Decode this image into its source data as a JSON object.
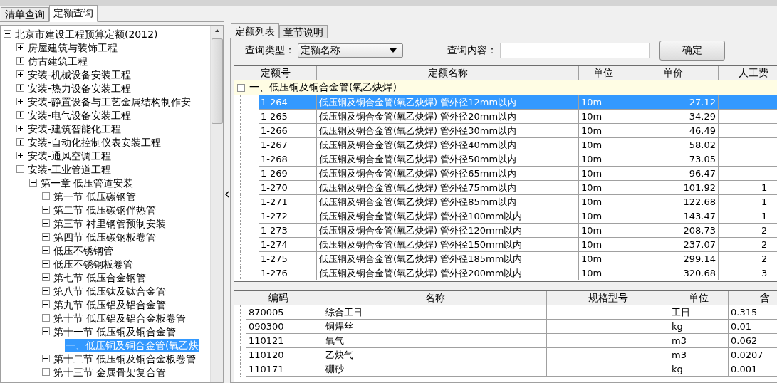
{
  "left_tabs": [
    {
      "label": "清单查询",
      "selected": false
    },
    {
      "label": "定额查询",
      "selected": true
    }
  ],
  "tree": [
    {
      "label": "北京市建设工程预算定额(2012)",
      "expanded": true,
      "selected": false,
      "children": [
        {
          "label": "房屋建筑与装饰工程",
          "expanded": false,
          "selected": false
        },
        {
          "label": "仿古建筑工程",
          "expanded": false,
          "selected": false
        },
        {
          "label": "安装-机械设备安装工程",
          "expanded": false,
          "selected": false
        },
        {
          "label": "安装-热力设备安装工程",
          "expanded": false,
          "selected": false
        },
        {
          "label": "安装-静置设备与工艺金属结构制作安",
          "expanded": false,
          "selected": false
        },
        {
          "label": "安装-电气设备安装工程",
          "expanded": false,
          "selected": false
        },
        {
          "label": "安装-建筑智能化工程",
          "expanded": false,
          "selected": false
        },
        {
          "label": "安装-自动化控制仪表安装工程",
          "expanded": false,
          "selected": false
        },
        {
          "label": "安装-通风空调工程",
          "expanded": false,
          "selected": false
        },
        {
          "label": "安装-工业管道工程",
          "expanded": true,
          "selected": false,
          "children": [
            {
              "label": "第一章  低压管道安装",
              "expanded": true,
              "selected": false,
              "children": [
                {
                  "label": "第一节  低压碳钢管",
                  "expanded": false,
                  "selected": false
                },
                {
                  "label": "第二节  低压碳钢伴热管",
                  "expanded": false,
                  "selected": false
                },
                {
                  "label": "第三节  衬里钢管预制安装",
                  "expanded": false,
                  "selected": false
                },
                {
                  "label": "第四节  低压碳钢板卷管",
                  "expanded": false,
                  "selected": false
                },
                {
                  "label": "低压不锈钢管",
                  "expanded": false,
                  "selected": false
                },
                {
                  "label": "低压不锈钢板卷管",
                  "expanded": false,
                  "selected": false
                },
                {
                  "label": "第七节  低压合金钢管",
                  "expanded": false,
                  "selected": false
                },
                {
                  "label": "第八节  低压钛及钛合金管",
                  "expanded": false,
                  "selected": false
                },
                {
                  "label": "第九节  低压铝及铝合金管",
                  "expanded": false,
                  "selected": false
                },
                {
                  "label": "第十节  低压铝及铝合金板卷管",
                  "expanded": false,
                  "selected": false
                },
                {
                  "label": "第十一节  低压铜及铜合金管",
                  "expanded": true,
                  "selected": false,
                  "children": [
                    {
                      "label": "一、低压铜及铜合金管(氧乙炔",
                      "selected": true
                    }
                  ]
                },
                {
                  "label": "第十二节  低压铜及铜合金板卷管",
                  "expanded": false,
                  "selected": false
                },
                {
                  "label": "第十三节  金属骨架复合管",
                  "expanded": false,
                  "selected": false
                }
              ]
            }
          ]
        }
      ]
    }
  ],
  "right_tabs": [
    {
      "label": "定额列表",
      "selected": true
    },
    {
      "label": "章节说明",
      "selected": false
    }
  ],
  "query": {
    "type_label": "查询类型：",
    "type_value": "定额名称",
    "content_label": "查询内容：",
    "confirm": "确定"
  },
  "quota_table": {
    "columns": [
      "定额号",
      "定额名称",
      "单位",
      "单价",
      "人工费"
    ],
    "group": {
      "label": "一、低压铜及铜合金管(氧乙炔焊)",
      "expanded": true
    },
    "rows": [
      {
        "code": "1-264",
        "name": "低压铜及铜合金管(氧乙炔焊) 管外径12mm以内",
        "unit": "10m",
        "price": "27.12",
        "selected": true
      },
      {
        "code": "1-265",
        "name": "低压铜及铜合金管(氧乙炔焊) 管外径20mm以内",
        "unit": "10m",
        "price": "34.29",
        "selected": false
      },
      {
        "code": "1-266",
        "name": "低压铜及铜合金管(氧乙炔焊) 管外径30mm以内",
        "unit": "10m",
        "price": "46.49",
        "selected": false
      },
      {
        "code": "1-267",
        "name": "低压铜及铜合金管(氧乙炔焊) 管外径40mm以内",
        "unit": "10m",
        "price": "58.02",
        "selected": false
      },
      {
        "code": "1-268",
        "name": "低压铜及铜合金管(氧乙炔焊) 管外径50mm以内",
        "unit": "10m",
        "price": "73.05",
        "selected": false
      },
      {
        "code": "1-269",
        "name": "低压铜及铜合金管(氧乙炔焊) 管外径65mm以内",
        "unit": "10m",
        "price": "96.47",
        "selected": false
      },
      {
        "code": "1-270",
        "name": "低压铜及铜合金管(氧乙炔焊) 管外径75mm以内",
        "unit": "10m",
        "price": "101.92",
        "labor": "1",
        "selected": false
      },
      {
        "code": "1-271",
        "name": "低压铜及铜合金管(氧乙炔焊) 管外径85mm以内",
        "unit": "10m",
        "price": "122.68",
        "labor": "1",
        "selected": false
      },
      {
        "code": "1-272",
        "name": "低压铜及铜合金管(氧乙炔焊) 管外径100mm以内",
        "unit": "10m",
        "price": "143.47",
        "labor": "1",
        "selected": false
      },
      {
        "code": "1-273",
        "name": "低压铜及铜合金管(氧乙炔焊) 管外径120mm以内",
        "unit": "10m",
        "price": "208.73",
        "labor": "2",
        "selected": false
      },
      {
        "code": "1-274",
        "name": "低压铜及铜合金管(氧乙炔焊) 管外径150mm以内",
        "unit": "10m",
        "price": "237.07",
        "labor": "2",
        "selected": false
      },
      {
        "code": "1-275",
        "name": "低压铜及铜合金管(氧乙炔焊) 管外径185mm以内",
        "unit": "10m",
        "price": "299.14",
        "labor": "2",
        "selected": false
      },
      {
        "code": "1-276",
        "name": "低压铜及铜合金管(氧乙炔焊) 管外径200mm以内",
        "unit": "10m",
        "price": "320.68",
        "labor": "3",
        "selected": false
      }
    ]
  },
  "material_table": {
    "columns": [
      "编码",
      "名称",
      "规格型号",
      "单位",
      "含"
    ],
    "rows": [
      {
        "code": "870005",
        "name": "综合工日",
        "unit": "工日",
        "amount": "0.315"
      },
      {
        "code": "090300",
        "name": "铜焊丝",
        "unit": "kg",
        "amount": "0.01"
      },
      {
        "code": "110121",
        "name": "氧气",
        "unit": "m3",
        "amount": "0.062"
      },
      {
        "code": "110120",
        "name": "乙炔气",
        "unit": "m3",
        "amount": "0.0207"
      },
      {
        "code": "110171",
        "name": "硼砂",
        "unit": "kg",
        "amount": "0.001"
      }
    ]
  }
}
